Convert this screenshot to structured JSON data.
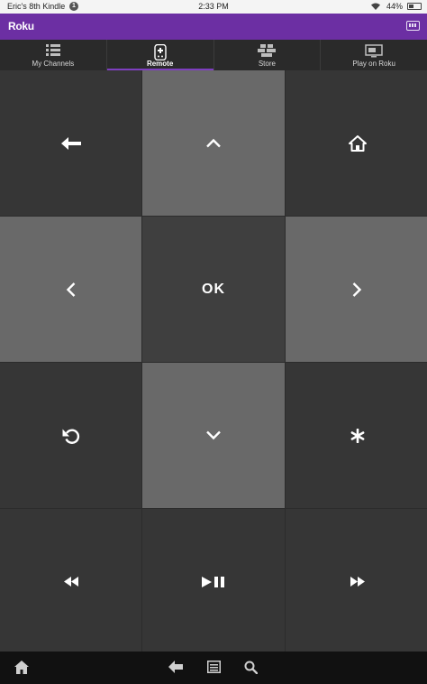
{
  "status_bar": {
    "device_name": "Eric's 8th Kindle",
    "notification_count": "1",
    "time": "2:33 PM",
    "battery": "44%",
    "battery_level": 0.44
  },
  "app": {
    "title": "Roku",
    "accent_color": "#6c2fa3"
  },
  "tabs": [
    {
      "label": "My Channels",
      "icon": "channels-list-icon",
      "active": false
    },
    {
      "label": "Remote",
      "icon": "remote-icon",
      "active": true
    },
    {
      "label": "Store",
      "icon": "store-icon",
      "active": false
    },
    {
      "label": "Play on Roku",
      "icon": "play-on-tv-icon",
      "active": false
    }
  ],
  "remote_keys": [
    {
      "name": "back",
      "icon": "back-arrow-icon"
    },
    {
      "name": "up",
      "icon": "chevron-up-icon"
    },
    {
      "name": "home",
      "icon": "home-icon"
    },
    {
      "name": "left",
      "icon": "chevron-left-icon"
    },
    {
      "name": "ok",
      "label": "OK"
    },
    {
      "name": "right",
      "icon": "chevron-right-icon"
    },
    {
      "name": "instant-replay",
      "icon": "replay-icon"
    },
    {
      "name": "down",
      "icon": "chevron-down-icon"
    },
    {
      "name": "options",
      "icon": "asterisk-icon"
    },
    {
      "name": "rewind",
      "icon": "rewind-icon"
    },
    {
      "name": "play-pause",
      "icon": "play-pause-icon"
    },
    {
      "name": "fast-forward",
      "icon": "fast-forward-icon"
    }
  ],
  "nav_bar": [
    {
      "name": "home",
      "icon": "home-icon"
    },
    {
      "name": "back",
      "icon": "back-icon"
    },
    {
      "name": "menu",
      "icon": "menu-icon"
    },
    {
      "name": "search",
      "icon": "search-icon"
    }
  ]
}
